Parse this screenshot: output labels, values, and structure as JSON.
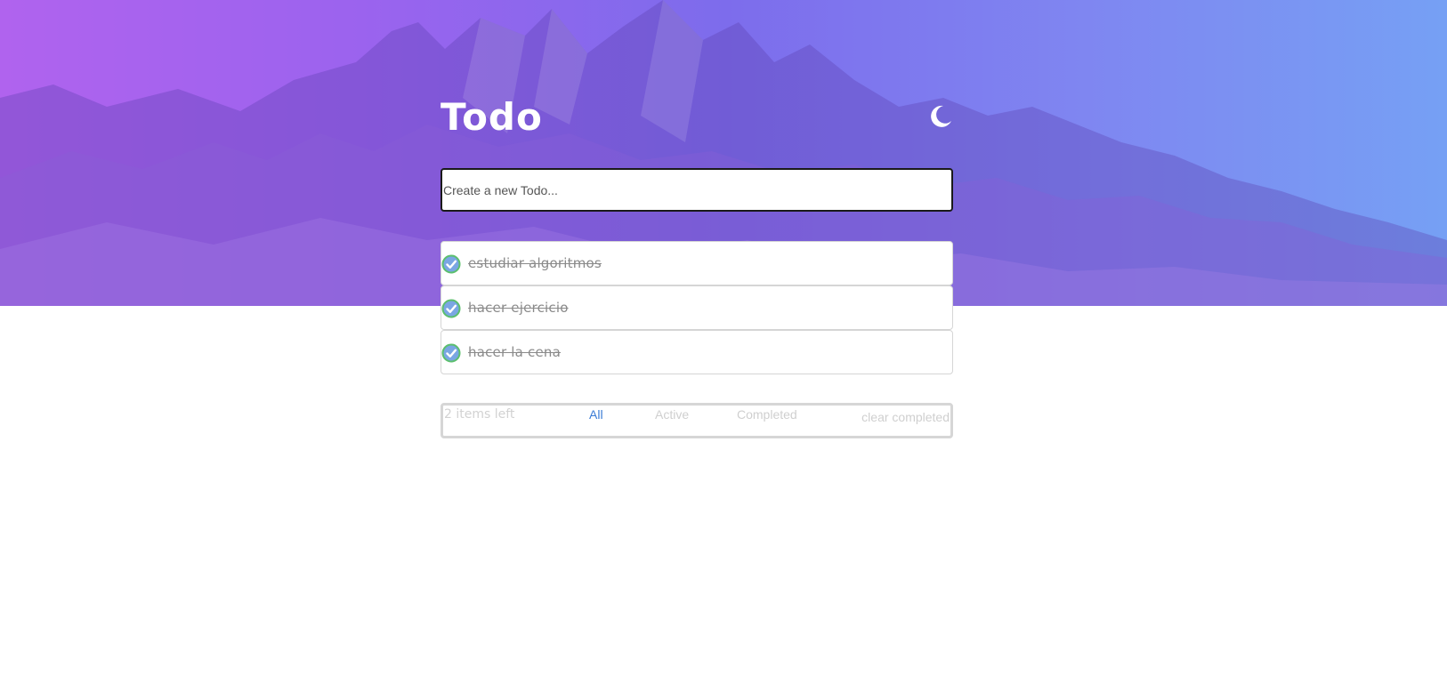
{
  "app": {
    "title": "Todo",
    "theme_toggle_icon": "moon-icon",
    "background_image": "mountain-range-photo"
  },
  "new_todo": {
    "placeholder": "Create a new Todo...",
    "value": ""
  },
  "todos": [
    {
      "text": "estudiar algoritmos",
      "completed": true
    },
    {
      "text": "hacer ejercicio",
      "completed": true
    },
    {
      "text": "hacer la cena",
      "completed": true
    }
  ],
  "footer": {
    "items_left": "2 items left",
    "filters": {
      "all": "All",
      "active": "Active",
      "completed": "Completed"
    },
    "selected_filter": "All",
    "clear_completed": "clear completed"
  },
  "colors": {
    "gradient_start": "#b063ee",
    "gradient_end": "#76a0f4",
    "check_fill": "#7aa6e3",
    "check_border": "#5cbf6e",
    "active_filter": "#3a7bd5"
  }
}
